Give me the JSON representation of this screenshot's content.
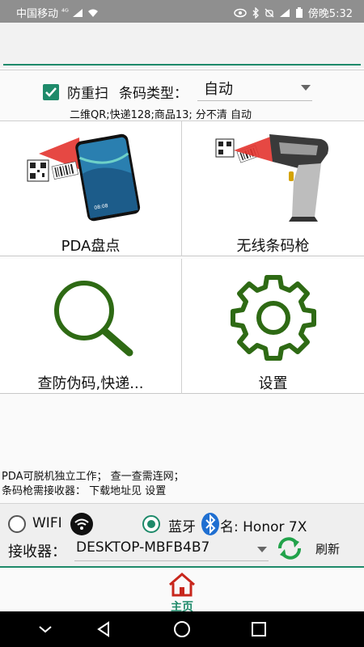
{
  "status": {
    "carrier": "中国移动",
    "signal": "⁴ᴳ",
    "time": "傍晚5:32"
  },
  "scan": {
    "dup_label": "防重扫",
    "type_label": "条码类型：",
    "type_value": "自动",
    "type_note": "二维QR;快递128;商品13; 分不清 自动"
  },
  "tiles": {
    "pda": "PDA盘点",
    "wireless": "无线条码枪",
    "antifake": "查防伪码,快递...",
    "settings": "设置"
  },
  "info": {
    "line1": "PDA可脱机独立工作；  查一查需连网；",
    "line2": "条码枪需接收器：  下载地址见 设置"
  },
  "receiver": {
    "wifi_label": "WIFI",
    "bt_label": "蓝牙",
    "bt_name": "名: Honor 7X",
    "receiver_label": "接收器：",
    "receiver_value": "DESKTOP-MBFB4B7",
    "refresh_label": "刷新"
  },
  "tabbar": {
    "home_label": "主页"
  },
  "colors": {
    "accent": "#1e8a6a",
    "icon_green": "#2e6a14",
    "home_red": "#c8261c"
  }
}
